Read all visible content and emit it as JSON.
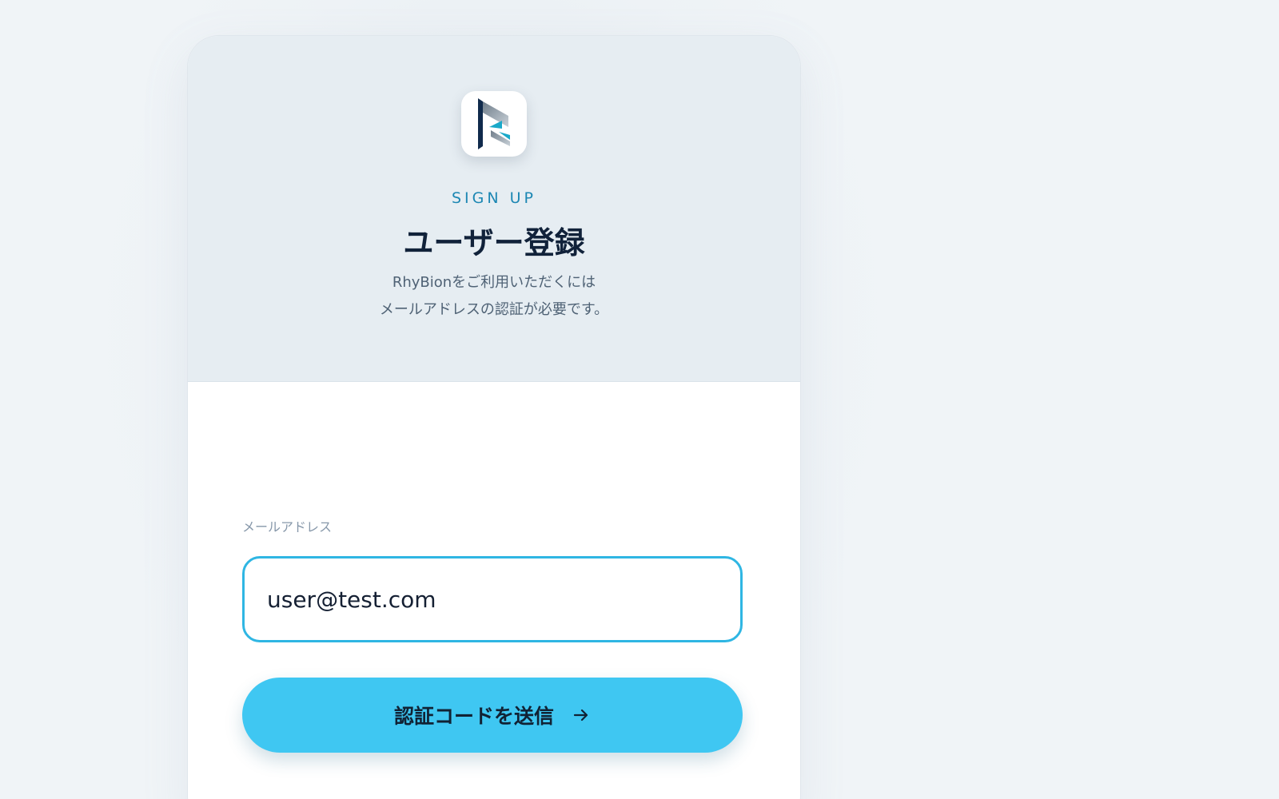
{
  "header": {
    "eyebrow": "SIGN UP",
    "title": "ユーザー登録",
    "subtitle_line1": "RhyBionをご利用いただくには",
    "subtitle_line2": "メールアドレスの認証が必要です。"
  },
  "form": {
    "email_label": "メールアドレス",
    "email_value": "user@test.com",
    "submit_label": "認証コードを送信"
  },
  "icons": {
    "logo": "rhybion-logo-icon",
    "submit": "arrow-right-icon"
  },
  "colors": {
    "accent": "#1c87b3",
    "button": "#3fc7f2",
    "input_border": "#2fb6e3",
    "title": "#11223a"
  }
}
